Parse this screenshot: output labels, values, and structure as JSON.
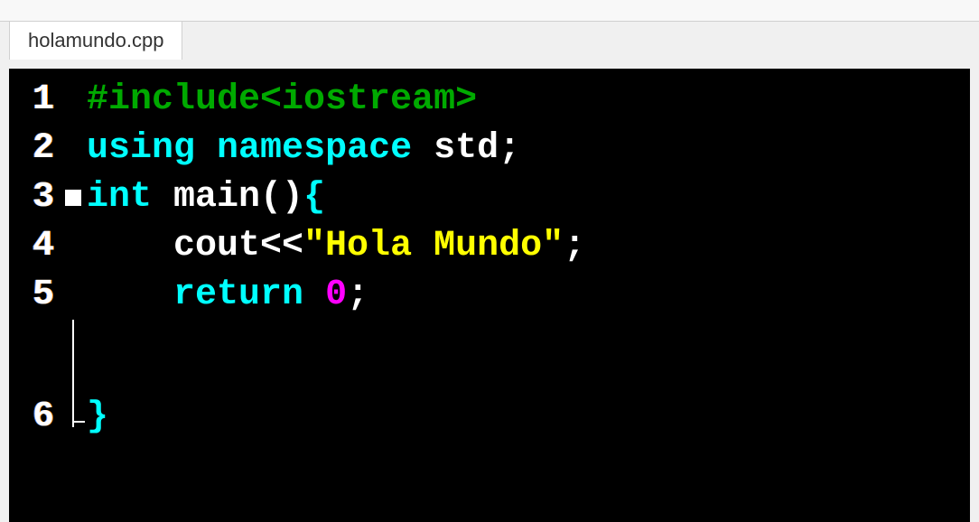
{
  "tab": {
    "filename": "holamundo.cpp"
  },
  "editor": {
    "line_numbers": [
      "1",
      "2",
      "3",
      "4",
      "5",
      "6"
    ],
    "lines": {
      "l1": {
        "preproc": "#include<iostream>"
      },
      "l2": {
        "kw1": "using",
        "sp1": " ",
        "kw2": "namespace",
        "sp2": " ",
        "ident": "std",
        "punct": ";"
      },
      "l3": {
        "kw": "int",
        "sp1": " ",
        "fn": "main",
        "parens": "()",
        "brace": "{"
      },
      "l4": {
        "indent": "    ",
        "ident": "cout",
        "op": "<<",
        "str": "\"Hola Mundo\"",
        "punct": ";"
      },
      "l5": {
        "indent": "    ",
        "kw": "return",
        "sp1": " ",
        "num": "0",
        "punct": ";"
      },
      "l6": {
        "brace": "}"
      }
    }
  }
}
